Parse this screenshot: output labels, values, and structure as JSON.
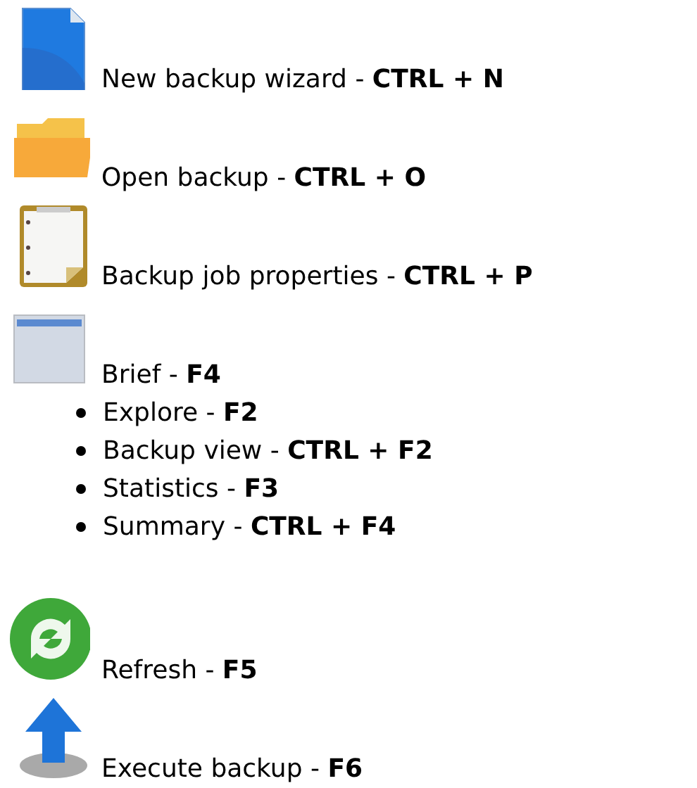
{
  "shortcuts": [
    {
      "kind": "document",
      "text": "New backup wizard - **CTRL + N**"
    },
    {
      "kind": "folder",
      "text": "Open backup - **CTRL + O**"
    },
    {
      "kind": "clipboard",
      "text": "Backup job properties - **CTRL + P**"
    },
    {
      "kind": "window",
      "text": "Brief - **F4**",
      "children": [
        {
          "text": "Explore - **F2**"
        },
        {
          "text": "Backup view - **CTRL + F2**"
        },
        {
          "text": "Statistics - **F3**"
        },
        {
          "text": "Summary - **CTRL + F4**"
        }
      ]
    },
    {
      "kind": "refresh",
      "text": "Refresh - **F5**"
    },
    {
      "kind": "upload",
      "text": "Execute backup - **F6**"
    }
  ]
}
